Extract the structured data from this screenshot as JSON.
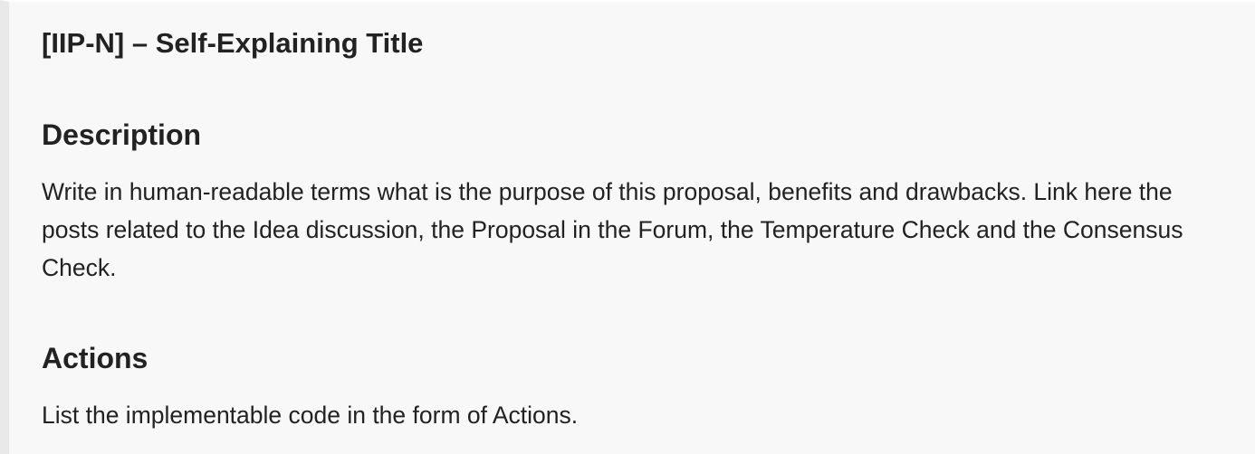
{
  "document": {
    "title": "[IIP-N] – Self-Explaining Title",
    "sections": [
      {
        "heading": "Description",
        "body": "Write in human-readable terms what is the purpose of this proposal, benefits and drawbacks. Link here the posts related to the Idea discussion, the Proposal in the Forum, the Temperature Check and the Consensus Check."
      },
      {
        "heading": "Actions",
        "body": "List the implementable code in the form of Actions."
      }
    ]
  },
  "colors": {
    "background": "#f8f8f8",
    "left_border": "#e9e9e9",
    "text": "#222222"
  }
}
